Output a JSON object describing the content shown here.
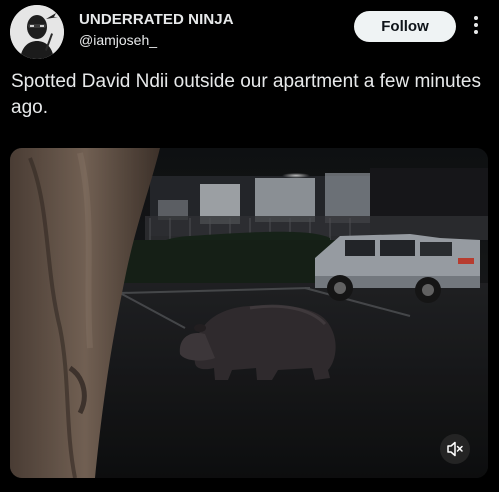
{
  "author": {
    "display_name": "UNDERRATED NINJA",
    "handle": "@iamjoseh_",
    "avatar_icon": "ninja-avatar-icon"
  },
  "actions": {
    "follow_label": "Follow",
    "more_icon": "more-options-icon"
  },
  "tweet": {
    "text": "Spotted David Ndii outside our apartment a few minutes ago."
  },
  "media": {
    "type": "video",
    "mute_icon": "speaker-muted-icon"
  },
  "colors": {
    "background": "#000000",
    "text": "#e7e9ea",
    "follow_button_bg": "#eff3f4",
    "follow_button_text": "#0f1419"
  }
}
